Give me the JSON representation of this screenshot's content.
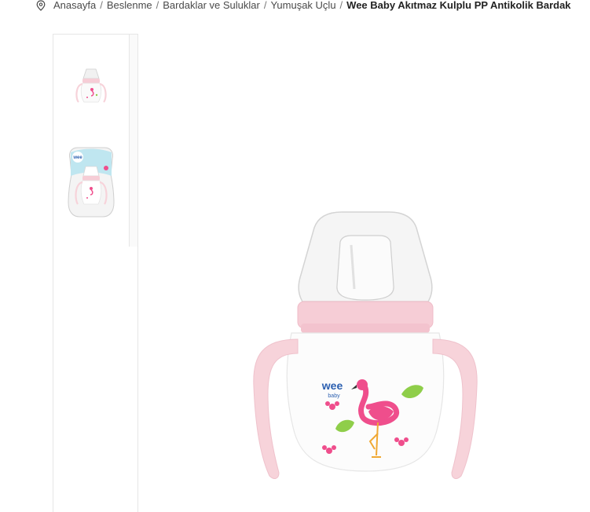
{
  "breadcrumb": {
    "icon": "map-pin-icon",
    "items": [
      "Anasayfa",
      "Beslenme",
      "Bardaklar ve Suluklar",
      "Yumuşak Uçlu"
    ],
    "separator": "/",
    "current": "Wee Baby Akıtmaz Kulplu PP Antikolik Bardak"
  },
  "product": {
    "main_image_alt": "Wee Baby Akıtmaz Kulplu PP Antikolik Bardak",
    "brand_mark_top": "wee",
    "brand_mark_bottom": "baby"
  },
  "gallery": {
    "thumbnails": [
      {
        "alt": "Wee Baby Akıtmaz Kulplu PP Antikolik Bardak"
      },
      {
        "alt": "Wee Baby Akıtmaz Kulplu PP Antikolik Bardak ambalaj"
      }
    ]
  },
  "colors": {
    "cup_pink": "#f6cdd6",
    "handle_pink": "#f7d3da",
    "flamingo": "#ef4e8c",
    "leaf_green": "#8fce4a",
    "brand_blue": "#2b5fb0"
  }
}
